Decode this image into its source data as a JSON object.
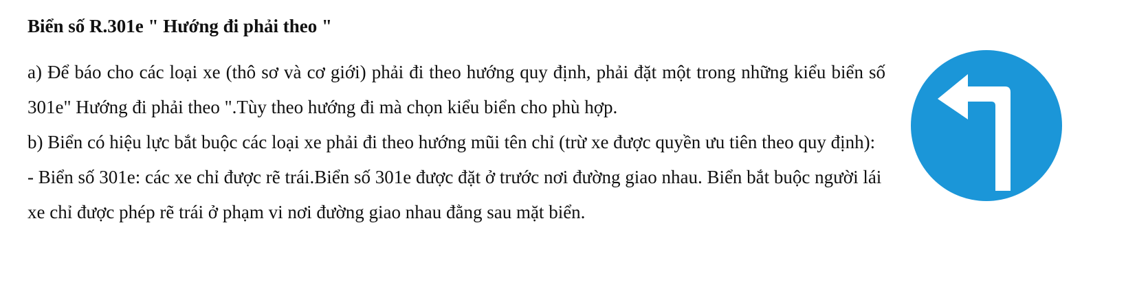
{
  "document": {
    "title": "Biển số R.301e \" Hướng đi phải theo \"",
    "paragraphs": [
      "a) Để báo cho các loại xe (thô sơ và cơ giới) phải đi theo hướng quy định, phải đặt một trong những kiểu biển số 301e\" Hướng đi phải theo \".Tùy theo hướng đi mà chọn kiểu biển cho phù hợp.",
      "b) Biển có hiệu lực bắt buộc các loại xe phải đi theo hướng mũi tên chỉ (trừ xe được quyền ưu tiên theo quy định):",
      "- Biển số 301e: các xe chỉ được rẽ trái.Biển số 301e được đặt ở trước nơi đường giao nhau. Biển bắt buộc người lái xe chỉ được phép rẽ trái ở phạm vi nơi đường giao nhau đằng sau mặt biển."
    ]
  },
  "sign": {
    "icon": "turn-left-arrow-icon",
    "background_color": "#1b96d8",
    "arrow_color": "#ffffff"
  }
}
